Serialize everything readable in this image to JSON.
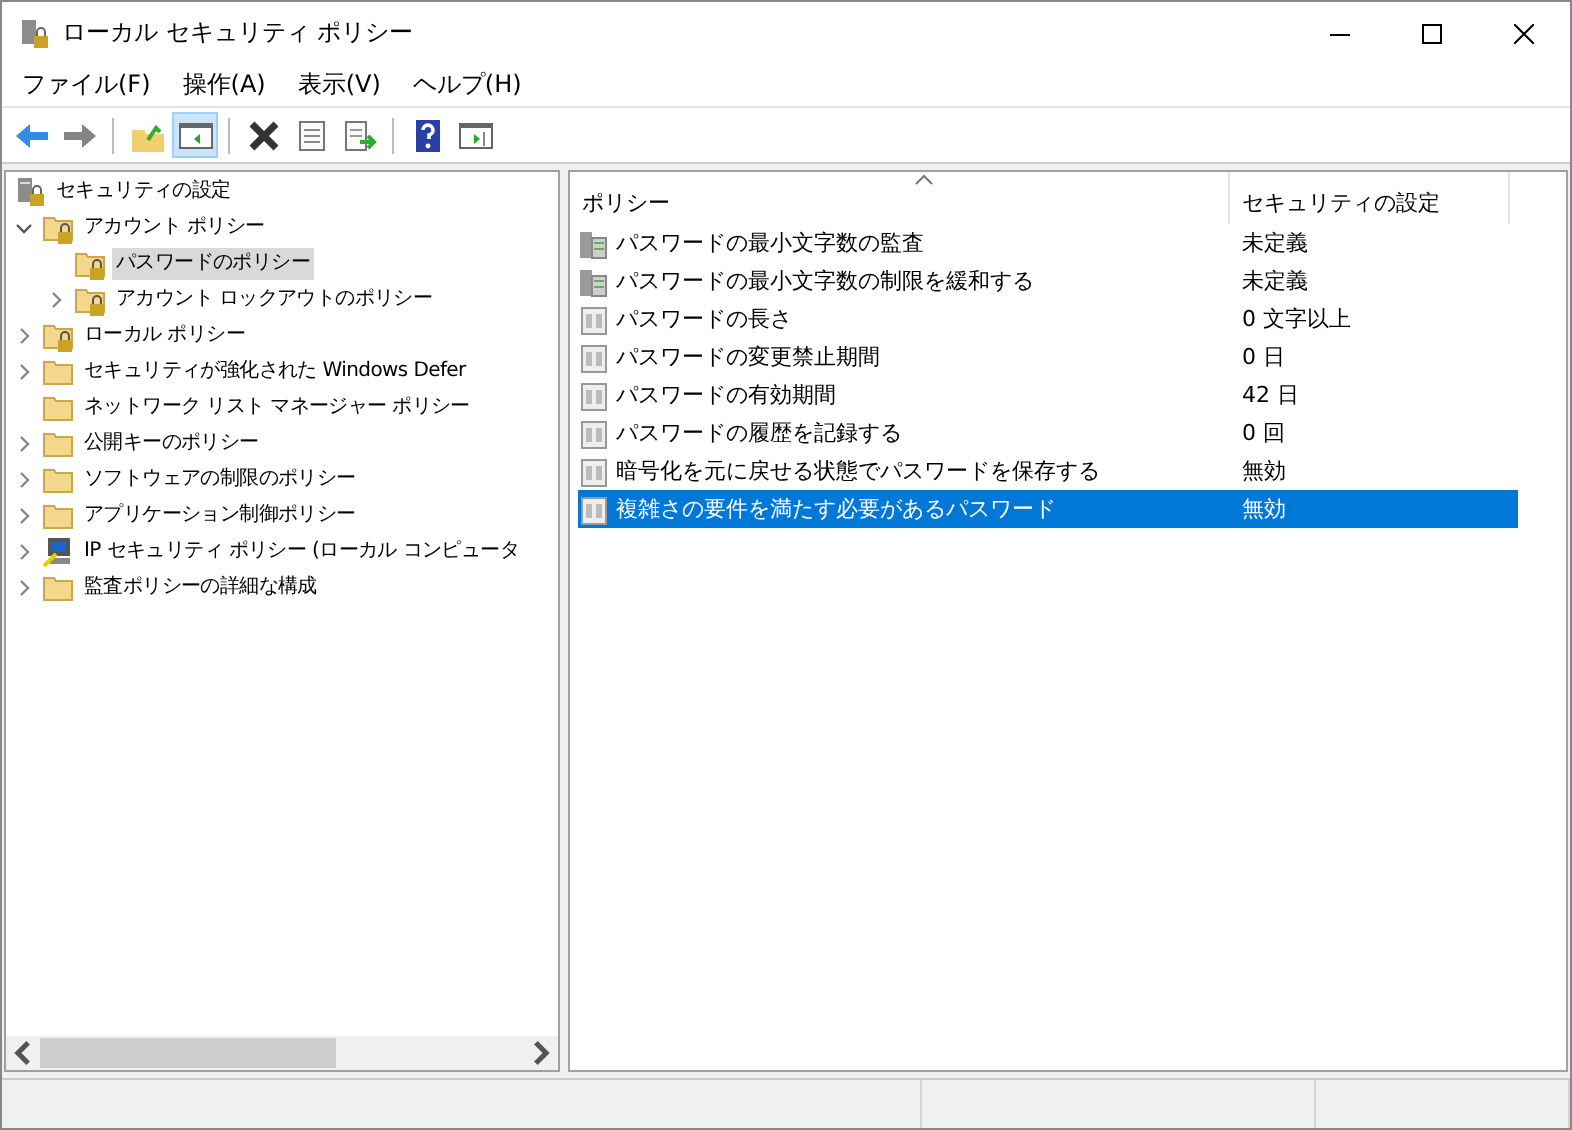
{
  "window": {
    "title": "ローカル セキュリティ ポリシー"
  },
  "menu": [
    "ファイル(F)",
    "操作(A)",
    "表示(V)",
    "ヘルプ(H)"
  ],
  "toolbar": [
    {
      "kind": "back",
      "disabled": false,
      "pressed": false
    },
    {
      "kind": "forward",
      "disabled": true,
      "pressed": false
    },
    {
      "kind": "sep"
    },
    {
      "kind": "up",
      "disabled": false,
      "pressed": false
    },
    {
      "kind": "tree",
      "disabled": false,
      "pressed": true
    },
    {
      "kind": "sep"
    },
    {
      "kind": "delete",
      "disabled": false,
      "pressed": false
    },
    {
      "kind": "properties",
      "disabled": false,
      "pressed": false
    },
    {
      "kind": "export",
      "disabled": false,
      "pressed": false
    },
    {
      "kind": "sep"
    },
    {
      "kind": "help",
      "disabled": false,
      "pressed": false
    },
    {
      "kind": "pane",
      "disabled": false,
      "pressed": false
    }
  ],
  "tree": [
    {
      "label": "セキュリティの設定",
      "kind": "computer",
      "selected": false,
      "children": [
        {
          "label": "アカウント ポリシー",
          "kind": "lockfolder",
          "selected": false,
          "expanded": true,
          "children": [
            {
              "label": "パスワードのポリシー",
              "kind": "lockfolder",
              "selected": true
            },
            {
              "label": "アカウント ロックアウトのポリシー",
              "kind": "lockfolder",
              "selected": false,
              "expanded": false,
              "has_children": true
            }
          ]
        },
        {
          "label": "ローカル ポリシー",
          "kind": "lockfolder",
          "selected": false,
          "expanded": false,
          "has_children": true
        },
        {
          "label": "セキュリティが強化された Windows Defer",
          "kind": "folder",
          "selected": false,
          "expanded": false,
          "has_children": true
        },
        {
          "label": "ネットワーク リスト マネージャー ポリシー",
          "kind": "folder",
          "selected": false
        },
        {
          "label": "公開キーのポリシー",
          "kind": "folder",
          "selected": false,
          "expanded": false,
          "has_children": true
        },
        {
          "label": "ソフトウェアの制限のポリシー",
          "kind": "folder",
          "selected": false,
          "expanded": false,
          "has_children": true
        },
        {
          "label": "アプリケーション制御ポリシー",
          "kind": "folder",
          "selected": false,
          "expanded": false,
          "has_children": true
        },
        {
          "label": "IP セキュリティ ポリシー (ローカル コンピュータ",
          "kind": "ip",
          "selected": false,
          "expanded": false,
          "has_children": true
        },
        {
          "label": "監査ポリシーの詳細な構成",
          "kind": "folder",
          "selected": false,
          "expanded": false,
          "has_children": true
        }
      ]
    }
  ],
  "table": {
    "columns": [
      "ポリシー",
      "セキュリティの設定"
    ],
    "rows": [
      {
        "policy": "パスワードの最小文字数の監査",
        "setting": "未定義",
        "kind": "server",
        "selected": false
      },
      {
        "policy": "パスワードの最小文字数の制限を緩和する",
        "setting": "未定義",
        "kind": "server",
        "selected": false
      },
      {
        "policy": "パスワードの長さ",
        "setting": "0 文字以上",
        "kind": "policy",
        "selected": false
      },
      {
        "policy": "パスワードの変更禁止期間",
        "setting": "0 日",
        "kind": "policy",
        "selected": false
      },
      {
        "policy": "パスワードの有効期間",
        "setting": "42 日",
        "kind": "policy",
        "selected": false
      },
      {
        "policy": "パスワードの履歴を記録する",
        "setting": "0 回",
        "kind": "policy",
        "selected": false
      },
      {
        "policy": "暗号化を元に戻せる状態でパスワードを保存する",
        "setting": "無効",
        "kind": "policy",
        "selected": false
      },
      {
        "policy": "複雑さの要件を満たす必要があるパスワード",
        "setting": "無効",
        "kind": "policy",
        "selected": true
      }
    ]
  }
}
